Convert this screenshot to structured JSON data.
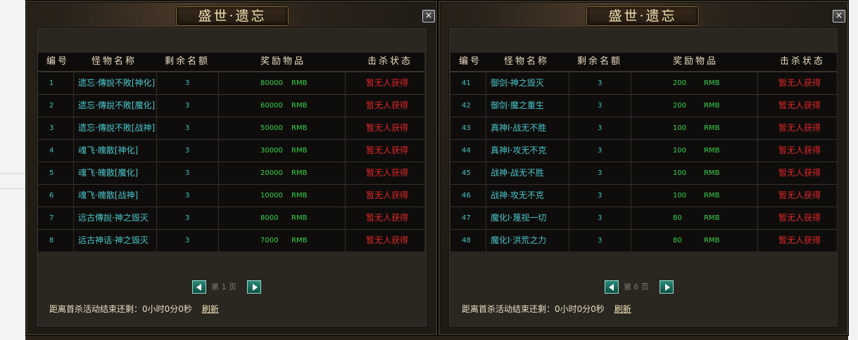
{
  "columns": [
    "编号",
    "怪物名称",
    "剩余名额",
    "奖励物品",
    "击杀状态"
  ],
  "panels": [
    {
      "title": "盛世·遗忘",
      "close_label": "×",
      "rows": [
        {
          "idx": "1",
          "name": "遗忘·傳說不敗[神化]",
          "qty": "3",
          "amount": "80000",
          "unit": "RMB",
          "status": "暂无人获得"
        },
        {
          "idx": "2",
          "name": "遗忘·傳說不敗[魔化]",
          "qty": "3",
          "amount": "60000",
          "unit": "RMB",
          "status": "暂无人获得"
        },
        {
          "idx": "3",
          "name": "遗忘·傳說不敗[战神]",
          "qty": "3",
          "amount": "50000",
          "unit": "RMB",
          "status": "暂无人获得"
        },
        {
          "idx": "4",
          "name": "魂飞·魄散[神化]",
          "qty": "3",
          "amount": "30000",
          "unit": "RMB",
          "status": "暂无人获得"
        },
        {
          "idx": "5",
          "name": "魂飞·魄散[魔化]",
          "qty": "3",
          "amount": "20000",
          "unit": "RMB",
          "status": "暂无人获得"
        },
        {
          "idx": "6",
          "name": "魂飞·魄散[战神]",
          "qty": "3",
          "amount": "10000",
          "unit": "RMB",
          "status": "暂无人获得"
        },
        {
          "idx": "7",
          "name": "远古傳說·神之毁灭",
          "qty": "3",
          "amount": "8000",
          "unit": "RMB",
          "status": "暂无人获得"
        },
        {
          "idx": "8",
          "name": "远古神话·神之毁灭",
          "qty": "3",
          "amount": "7000",
          "unit": "RMB",
          "status": "暂无人获得"
        }
      ],
      "pager": {
        "prefix": "第",
        "page": "1",
        "suffix": "页"
      },
      "footer": {
        "label": "距离首杀活动结束还剩：",
        "time": "0小时0分0秒",
        "refresh": "刷新"
      }
    },
    {
      "title": "盛世·遗忘",
      "close_label": "×",
      "rows": [
        {
          "idx": "41",
          "name": "御剑·神之毁灭",
          "qty": "3",
          "amount": "200",
          "unit": "RMB",
          "status": "暂无人获得"
        },
        {
          "idx": "42",
          "name": "御剑·魔之重生",
          "qty": "3",
          "amount": "200",
          "unit": "RMB",
          "status": "暂无人获得"
        },
        {
          "idx": "43",
          "name": "真神Ⅰ·战无不胜",
          "qty": "3",
          "amount": "100",
          "unit": "RMB",
          "status": "暂无人获得"
        },
        {
          "idx": "44",
          "name": "真神Ⅰ·攻无不克",
          "qty": "3",
          "amount": "100",
          "unit": "RMB",
          "status": "暂无人获得"
        },
        {
          "idx": "45",
          "name": "战神·战无不胜",
          "qty": "3",
          "amount": "100",
          "unit": "RMB",
          "status": "暂无人获得"
        },
        {
          "idx": "46",
          "name": "战神·攻无不克",
          "qty": "3",
          "amount": "100",
          "unit": "RMB",
          "status": "暂无人获得"
        },
        {
          "idx": "47",
          "name": "魔化Ⅰ·蔑视一切",
          "qty": "3",
          "amount": "80",
          "unit": "RMB",
          "status": "暂无人获得"
        },
        {
          "idx": "48",
          "name": "魔化Ⅰ·洪荒之力",
          "qty": "3",
          "amount": "80",
          "unit": "RMB",
          "status": "暂无人获得"
        }
      ],
      "pager": {
        "prefix": "第",
        "page": "6",
        "suffix": "页"
      },
      "footer": {
        "label": "距离首杀活动结束还剩：",
        "time": "0小时0分0秒",
        "refresh": "刷新"
      }
    }
  ],
  "colors": {
    "index": "#3fc3c5",
    "name": "#48c6cc",
    "reward": "#33d34a",
    "status": "#e02626",
    "header_text": "#e8dcc0"
  },
  "icons": {
    "close": "close-icon",
    "prev": "arrow-left-icon",
    "next": "arrow-right-icon"
  }
}
